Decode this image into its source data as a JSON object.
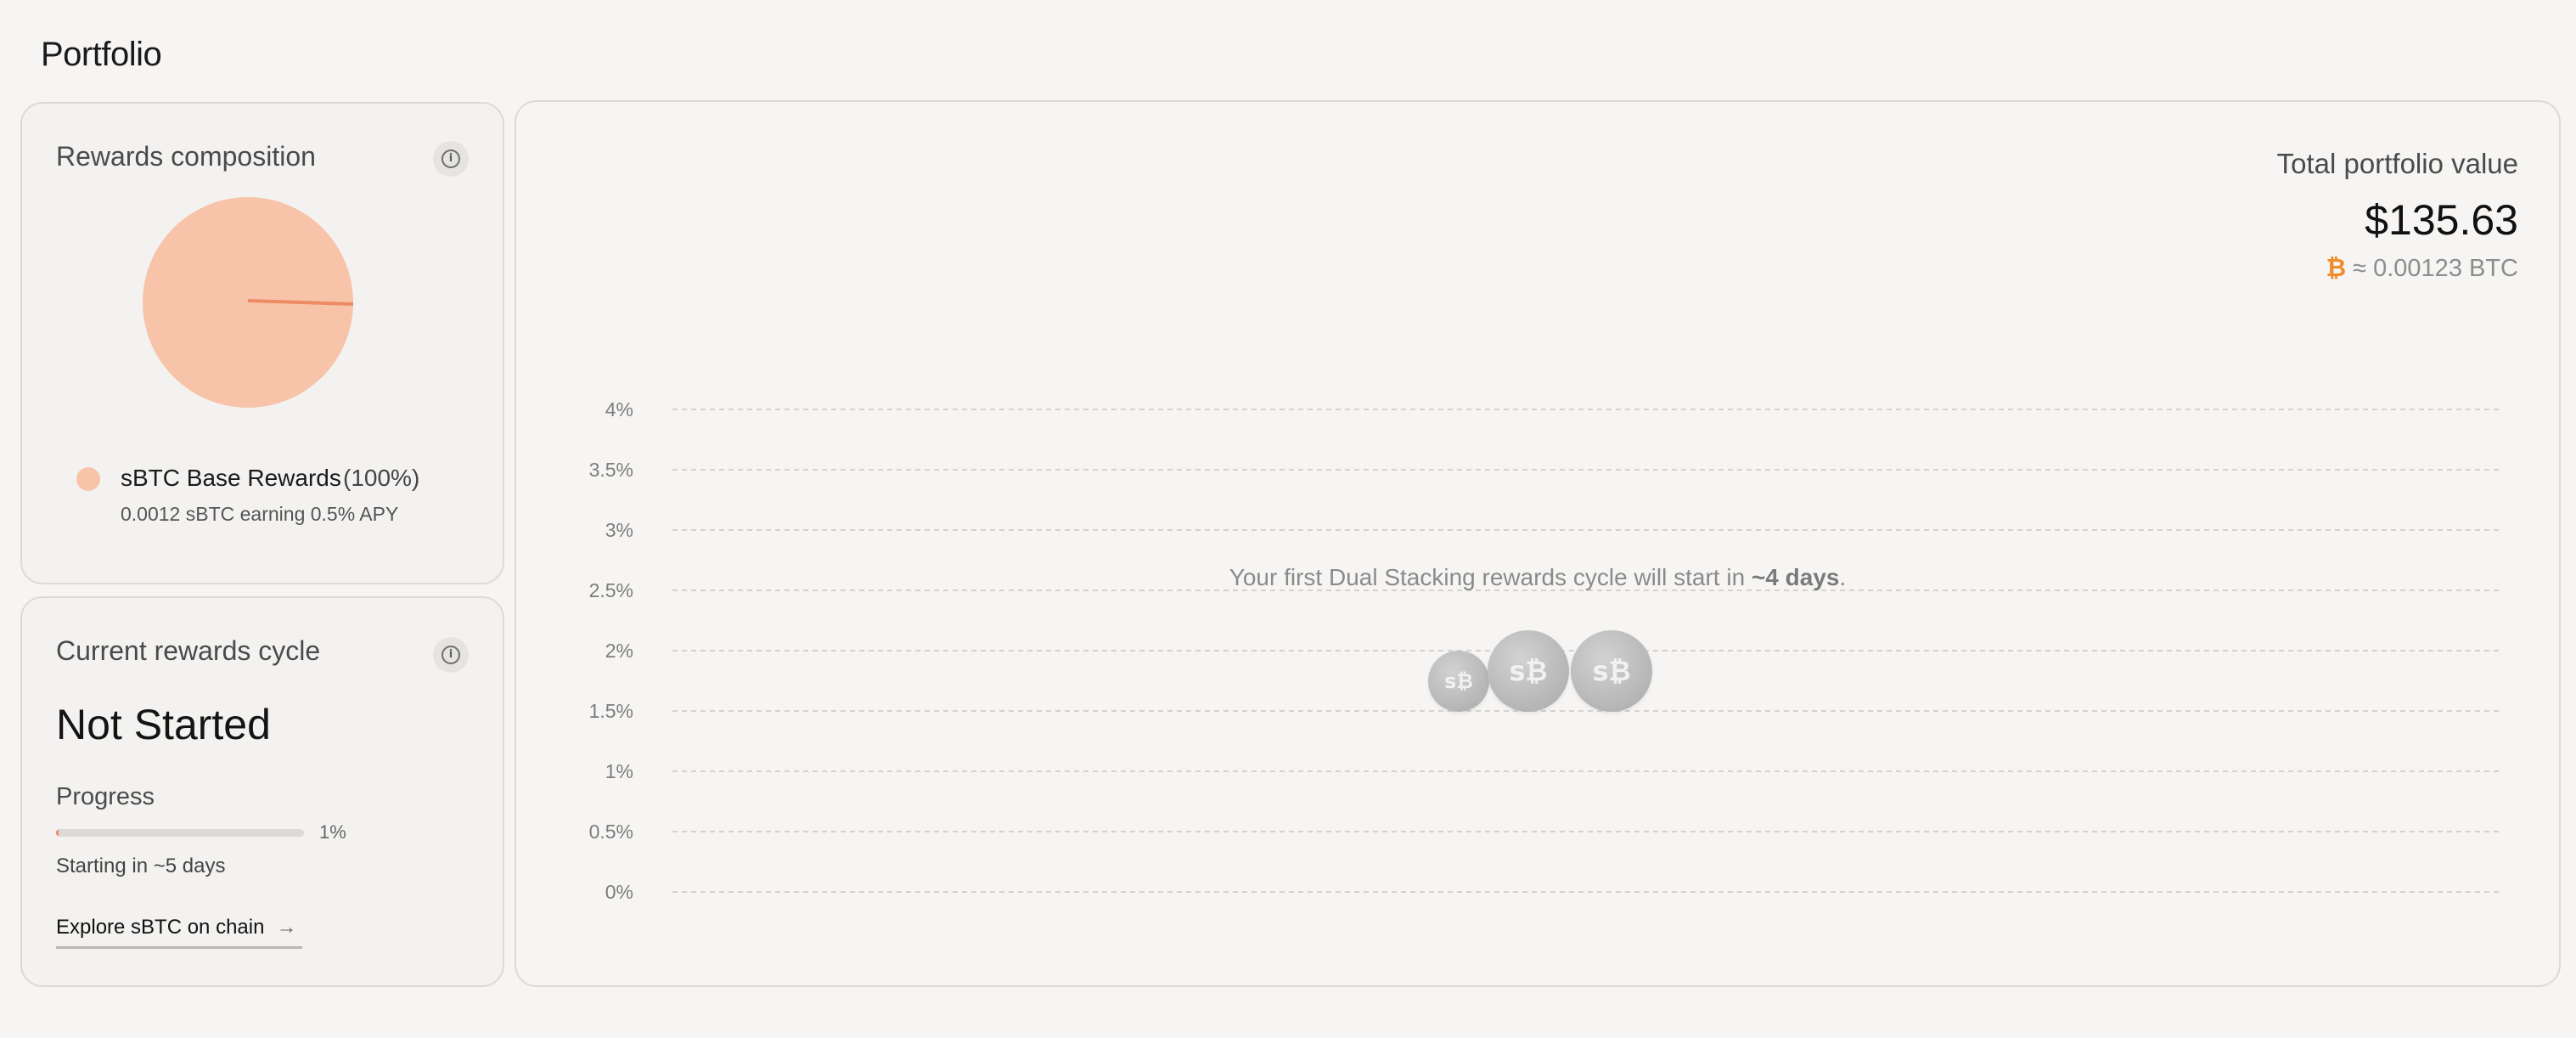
{
  "page": {
    "title": "Portfolio"
  },
  "rewards_composition": {
    "title": "Rewards composition",
    "info_icon": "info-icon",
    "legend": [
      {
        "name": "sBTC Base Rewards",
        "percent_label": "(100%)",
        "detail": "0.0012 sBTC earning 0.5% APY",
        "color": "#f7c4a9"
      }
    ]
  },
  "current_cycle": {
    "title": "Current rewards cycle",
    "info_icon": "info-icon",
    "status": "Not Started",
    "progress_label": "Progress",
    "progress_value": 0.01,
    "progress_pct_label": "1%",
    "starting_text": "Starting in ~5 days",
    "explore_link": "Explore sBTC on chain",
    "explore_arrow": "→"
  },
  "portfolio_value": {
    "label": "Total portfolio value",
    "value": "$135.63",
    "btc_symbol": "₿",
    "btc_equivalent": "≈ 0.00123 BTC"
  },
  "notice": {
    "prefix": "Your first Dual Stacking rewards cycle will start in ",
    "emphasis": "~4 days",
    "suffix": "."
  },
  "coin_label": "s₿",
  "chart_data": [
    {
      "type": "pie",
      "title": "Rewards composition",
      "slices": [
        {
          "label": "sBTC Base Rewards",
          "value": 100,
          "color": "#f7c4a9"
        }
      ]
    },
    {
      "type": "line",
      "y_ticks": [
        "4%",
        "3.5%",
        "3%",
        "2.5%",
        "2%",
        "1.5%",
        "1%",
        "0.5%",
        "0%"
      ],
      "ylim": [
        0,
        4
      ],
      "grid": true,
      "series": []
    }
  ],
  "colors": {
    "accent": "#ee8a64",
    "pie_fill": "#f7c4a9",
    "pie_line": "#ee8a64",
    "btc_orange": "#f08c2c",
    "grid": "#d4d2ce"
  }
}
